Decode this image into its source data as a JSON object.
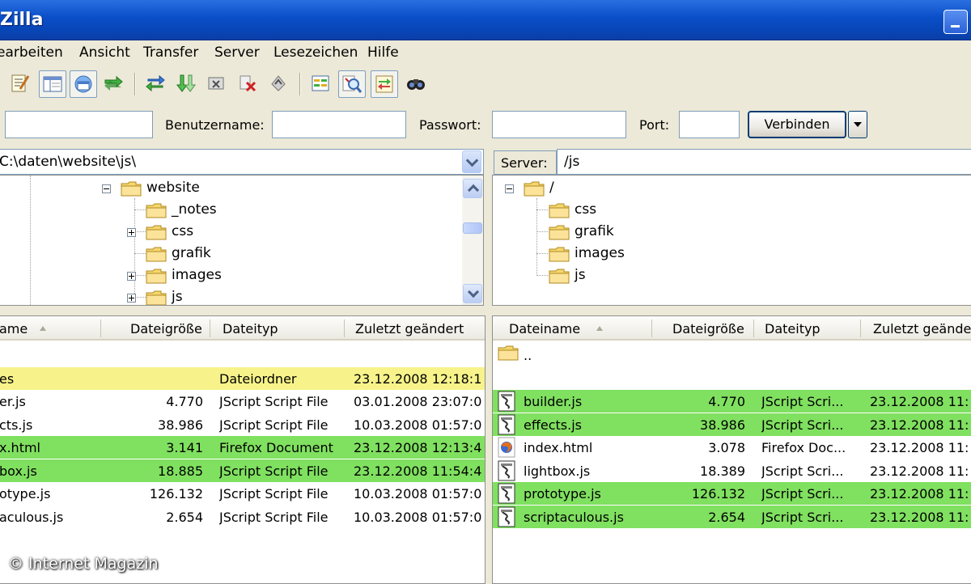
{
  "window": {
    "title": "Zilla"
  },
  "menu": [
    "earbeiten",
    "Ansicht",
    "Transfer",
    "Server",
    "Lesezeichen",
    "Hilfe"
  ],
  "toolbar": {
    "buttons": [
      "site-manager-icon",
      "log-toggle-icon",
      "local-tree-icon",
      "remote-tree-icon",
      "transfer-queue-icon",
      "refresh-icon",
      "process-queue-icon",
      "cancel-icon",
      "disconnect-icon",
      "reconnect-icon",
      "directory-compare-icon",
      "filter-icon",
      "sync-browsing-icon",
      "search-icon"
    ]
  },
  "quickconnect": {
    "host_value": "",
    "user_label": "Benutzername:",
    "user_value": "",
    "pass_label": "Passwort:",
    "pass_value": "",
    "port_label": "Port:",
    "port_value": "",
    "connect_label": "Verbinden"
  },
  "local": {
    "path": "C:\\daten\\website\\js\\",
    "tree": [
      {
        "label": "website",
        "expander": "minus"
      },
      {
        "label": "_notes",
        "expander": ""
      },
      {
        "label": "css",
        "expander": "plus"
      },
      {
        "label": "grafik",
        "expander": ""
      },
      {
        "label": "images",
        "expander": "plus"
      },
      {
        "label": "js",
        "expander": "plus"
      }
    ],
    "columns": [
      "ame",
      "Dateigröße",
      "Dateityp",
      "Zuletzt geändert"
    ],
    "rows": [
      {
        "name": "",
        "size": "",
        "type": "",
        "modified": "",
        "hl": ""
      },
      {
        "name": "es",
        "size": "",
        "type": "Dateiordner",
        "modified": "23.12.2008 12:18:1",
        "hl": "yellow"
      },
      {
        "name": "er.js",
        "size": "4.770",
        "type": "JScript Script File",
        "modified": "03.01.2008 23:07:0",
        "hl": ""
      },
      {
        "name": "cts.js",
        "size": "38.986",
        "type": "JScript Script File",
        "modified": "10.03.2008 01:57:0",
        "hl": ""
      },
      {
        "name": "x.html",
        "size": "3.141",
        "type": "Firefox Document",
        "modified": "23.12.2008 12:13:4",
        "hl": "green"
      },
      {
        "name": "box.js",
        "size": "18.885",
        "type": "JScript Script File",
        "modified": "23.12.2008 11:54:4",
        "hl": "green"
      },
      {
        "name": "otype.js",
        "size": "126.132",
        "type": "JScript Script File",
        "modified": "10.03.2008 01:57:0",
        "hl": ""
      },
      {
        "name": "aculous.js",
        "size": "2.654",
        "type": "JScript Script File",
        "modified": "10.03.2008 01:57:0",
        "hl": ""
      }
    ]
  },
  "remote": {
    "server_label": "Server:",
    "path": "/js",
    "tree": [
      {
        "label": "/",
        "expander": "minus"
      },
      {
        "label": "css",
        "expander": ""
      },
      {
        "label": "grafik",
        "expander": ""
      },
      {
        "label": "images",
        "expander": ""
      },
      {
        "label": "js",
        "expander": ""
      }
    ],
    "columns": [
      "Dateiname",
      "Dateigröße",
      "Dateityp",
      "Zuletzt geänder"
    ],
    "rows": [
      {
        "icon": "folder",
        "name": "..",
        "size": "",
        "type": "",
        "modified": "",
        "hl": ""
      },
      {
        "icon": "",
        "name": "",
        "size": "",
        "type": "",
        "modified": "",
        "hl": ""
      },
      {
        "icon": "script",
        "name": "builder.js",
        "size": "4.770",
        "type": "JScript Scri...",
        "modified": "23.12.2008 11:",
        "hl": "green"
      },
      {
        "icon": "script",
        "name": "effects.js",
        "size": "38.986",
        "type": "JScript Scri...",
        "modified": "23.12.2008 11:",
        "hl": "green"
      },
      {
        "icon": "firefox",
        "name": "index.html",
        "size": "3.078",
        "type": "Firefox Doc...",
        "modified": "23.12.2008 11:",
        "hl": ""
      },
      {
        "icon": "script",
        "name": "lightbox.js",
        "size": "18.389",
        "type": "JScript Scri...",
        "modified": "23.12.2008 11:",
        "hl": ""
      },
      {
        "icon": "script",
        "name": "prototype.js",
        "size": "126.132",
        "type": "JScript Scri...",
        "modified": "23.12.2008 11:",
        "hl": "green"
      },
      {
        "icon": "script",
        "name": "scriptaculous.js",
        "size": "2.654",
        "type": "JScript Scri...",
        "modified": "23.12.2008 11:",
        "hl": "green"
      }
    ]
  },
  "watermark": "© Internet Magazin",
  "colors": {
    "titlebar": "#0a4ec8",
    "sync_green": "#80e060",
    "folder_yellow": "#f7f38a"
  }
}
